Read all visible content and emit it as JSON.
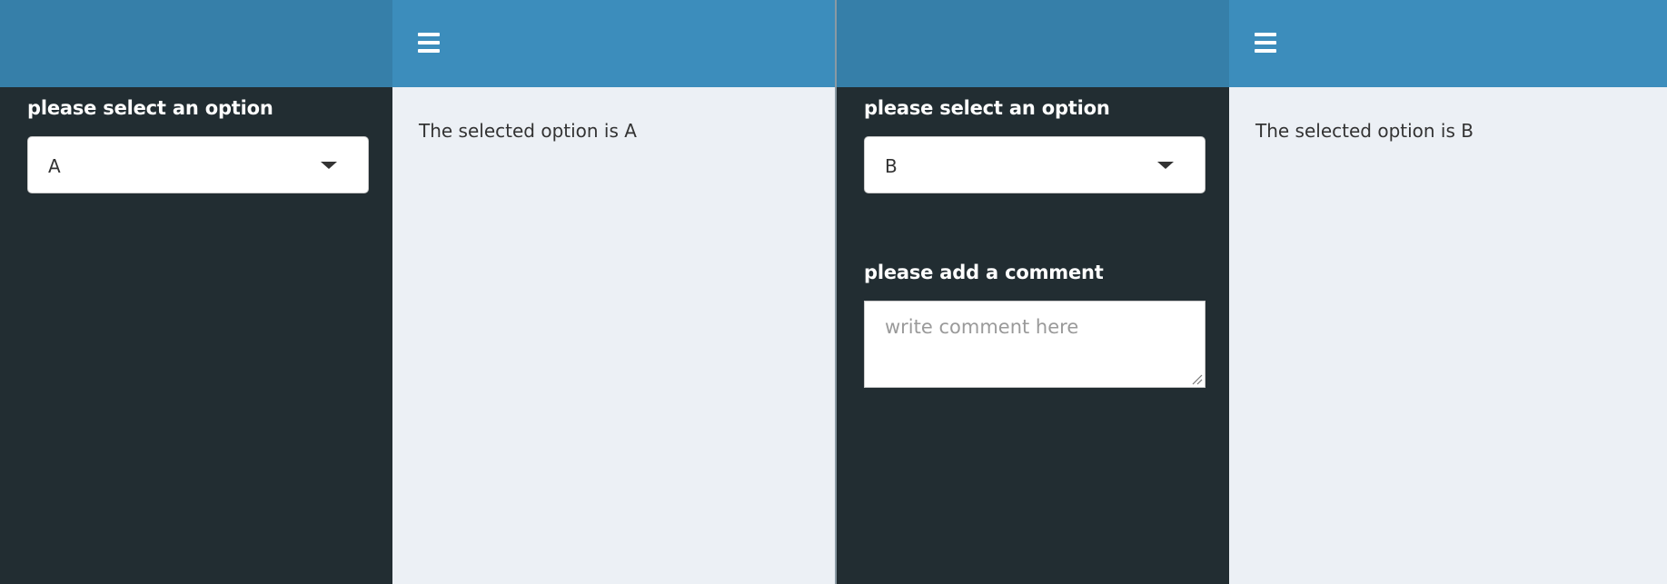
{
  "colors": {
    "header_brand": "#367fa9",
    "header_bar": "#3c8dbc",
    "sidebar": "#222d32",
    "content_bg": "#ecf0f5"
  },
  "left_app": {
    "header": {
      "menu_icon": "hamburger-menu-icon"
    },
    "sidebar": {
      "select_label": "please select an option",
      "select_value": "A",
      "select_icon": "chevron-down-icon"
    },
    "content": {
      "output": "The selected option is A"
    }
  },
  "right_app": {
    "header": {
      "menu_icon": "hamburger-menu-icon"
    },
    "sidebar": {
      "select_label": "please select an option",
      "select_value": "B",
      "select_icon": "chevron-down-icon",
      "comment_label": "please add a comment",
      "comment_placeholder": "write comment here",
      "comment_value": ""
    },
    "content": {
      "output": "The selected option is B"
    }
  }
}
